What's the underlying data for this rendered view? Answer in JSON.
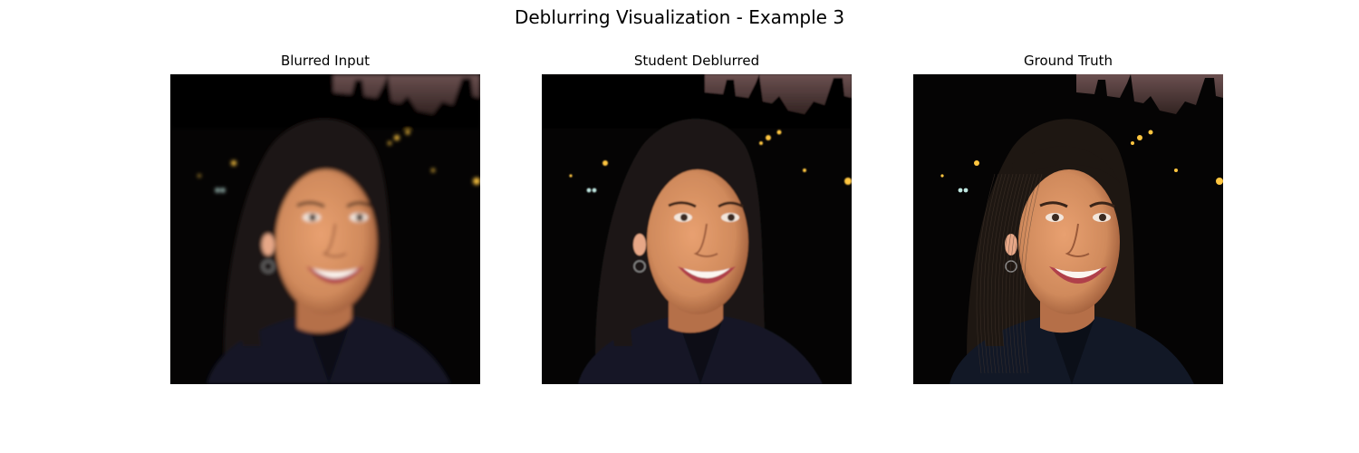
{
  "figure": {
    "title": "Deblurring Visualization - Example 3"
  },
  "panels": [
    {
      "title": "Blurred Input",
      "blur": 2.2,
      "sharp_detail": false
    },
    {
      "title": "Student Deblurred",
      "blur": 0.9,
      "sharp_detail": false
    },
    {
      "title": "Ground Truth",
      "blur": 0,
      "sharp_detail": true
    }
  ],
  "colors": {
    "background": "#ffffff",
    "scene_dark": "#050404",
    "sky_dusk": "#6b5050",
    "skin": "#d08a5c",
    "hair": "#1e1712",
    "jacket": "#121826",
    "light_warm": "#ffc640",
    "light_cool": "#bfe6e0"
  }
}
